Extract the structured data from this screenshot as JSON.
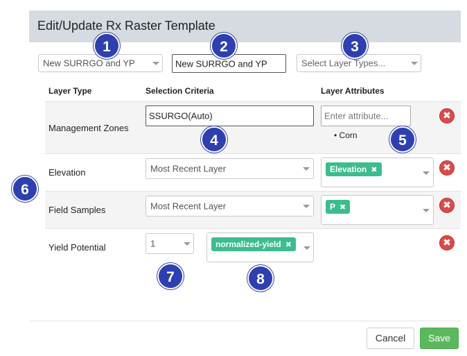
{
  "modal": {
    "title": "Edit/Update Rx Raster Template"
  },
  "top_controls": {
    "template_select": "New SURRGO and YP",
    "template_name": "New SURRGO and YP",
    "layer_types_placeholder": "Select Layer Types..."
  },
  "columns": {
    "layer_type": "Layer Type",
    "selection_criteria": "Selection Criteria",
    "layer_attributes": "Layer Attributes"
  },
  "rows": [
    {
      "label": "Management Zones",
      "criteria": "SSURGO(Auto)",
      "attribute_placeholder": "Enter attribute...",
      "attribute_items": [
        "Corn"
      ]
    },
    {
      "label": "Elevation",
      "criteria": "Most Recent Layer",
      "tags": [
        "Elevation"
      ]
    },
    {
      "label": "Field Samples",
      "criteria": "Most Recent Layer",
      "tags": [
        "P"
      ]
    },
    {
      "label": "Yield Potential",
      "criteria": "1",
      "tags": [
        "normalized-yield"
      ]
    }
  ],
  "remove_glyph": "✖",
  "tag_remove_glyph": "✖",
  "badges": [
    "1",
    "2",
    "3",
    "4",
    "5",
    "6",
    "7",
    "8"
  ],
  "footer": {
    "cancel": "Cancel",
    "save": "Save"
  },
  "colors": {
    "header_bg": "#d6dbe2",
    "tag_green": "#3dbc8d",
    "badge_blue": "#2e3fb0",
    "remove_red": "#d94b4b",
    "save_green": "#5cb85c"
  }
}
